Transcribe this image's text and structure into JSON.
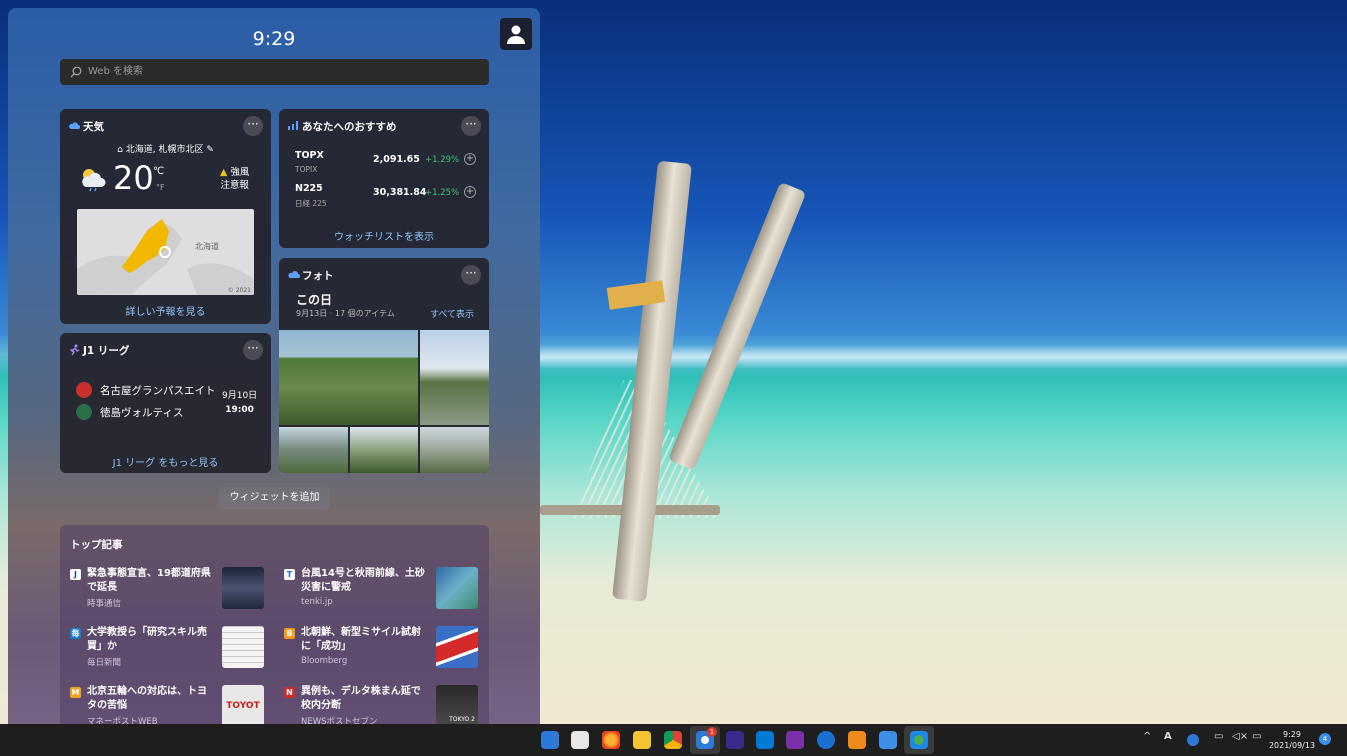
{
  "panel": {
    "clock": "9:29",
    "search_placeholder": "Web を検索",
    "add_widget_label": "ウィジェットを追加"
  },
  "weather": {
    "title": "天気",
    "location": "北海道, 札幌市北区",
    "temperature": "20",
    "unit_c": "℃",
    "unit_f": "°F",
    "alert_line1": "強風",
    "alert_line2": "注意報",
    "map_label": "北海道",
    "map_copyright": "© 2021",
    "forecast_link": "詳しい予報を見る"
  },
  "stocks": {
    "title": "あなたへのおすすめ",
    "rows": [
      {
        "symbol": "TOPX",
        "name": "TOPIX",
        "price": "2,091.65",
        "change": "+1.29%"
      },
      {
        "symbol": "N225",
        "name": "日経 225",
        "price": "30,381.84",
        "change": "+1.25%"
      }
    ],
    "watchlist_link": "ウォッチリストを表示"
  },
  "photos": {
    "title": "フォト",
    "heading": "この日",
    "subtitle": "9月13日 · 17 個のアイテム",
    "see_all": "すべて表示"
  },
  "j1": {
    "title": "J1 リーグ",
    "home_team": "名古屋グランパスエイト",
    "away_team": "徳島ヴォルティス",
    "date": "9月10日",
    "time": "19:00",
    "more_link": "J1 リーグ をもっと見る"
  },
  "news": {
    "heading": "トップ記事",
    "items": [
      {
        "title": "緊急事態宣言、19都道府県で延長",
        "source": "時事通信"
      },
      {
        "title": "台風14号と秋雨前線、土砂災害に警戒",
        "source": "tenki.jp"
      },
      {
        "title": "大学教授ら「研究スキル売買」か",
        "source": "毎日新聞"
      },
      {
        "title": "北朝鮮、新型ミサイル試射に「成功」",
        "source": "Bloomberg"
      },
      {
        "title": "北京五輪への対応は、トヨタの苦悩",
        "source": "マネーポストWEB"
      },
      {
        "title": "異例も、デルタ株まん延で校内分断",
        "source": "NEWSポストセブン"
      }
    ],
    "icon_letters": [
      "J",
      "T",
      "毎",
      "B",
      "M",
      "N"
    ],
    "thumb_text": [
      "",
      "",
      "",
      "",
      "TOYOT",
      "TOKYO 2"
    ]
  },
  "taskbar": {
    "badge_count": "1",
    "ime_indicator": "A",
    "time": "9:29",
    "date": "2021/09/13",
    "notification_count": "4"
  },
  "colors": {
    "accent_link": "#8fc4ff",
    "stock_up": "#3cc36a",
    "weather_alert": "#f2c811"
  }
}
